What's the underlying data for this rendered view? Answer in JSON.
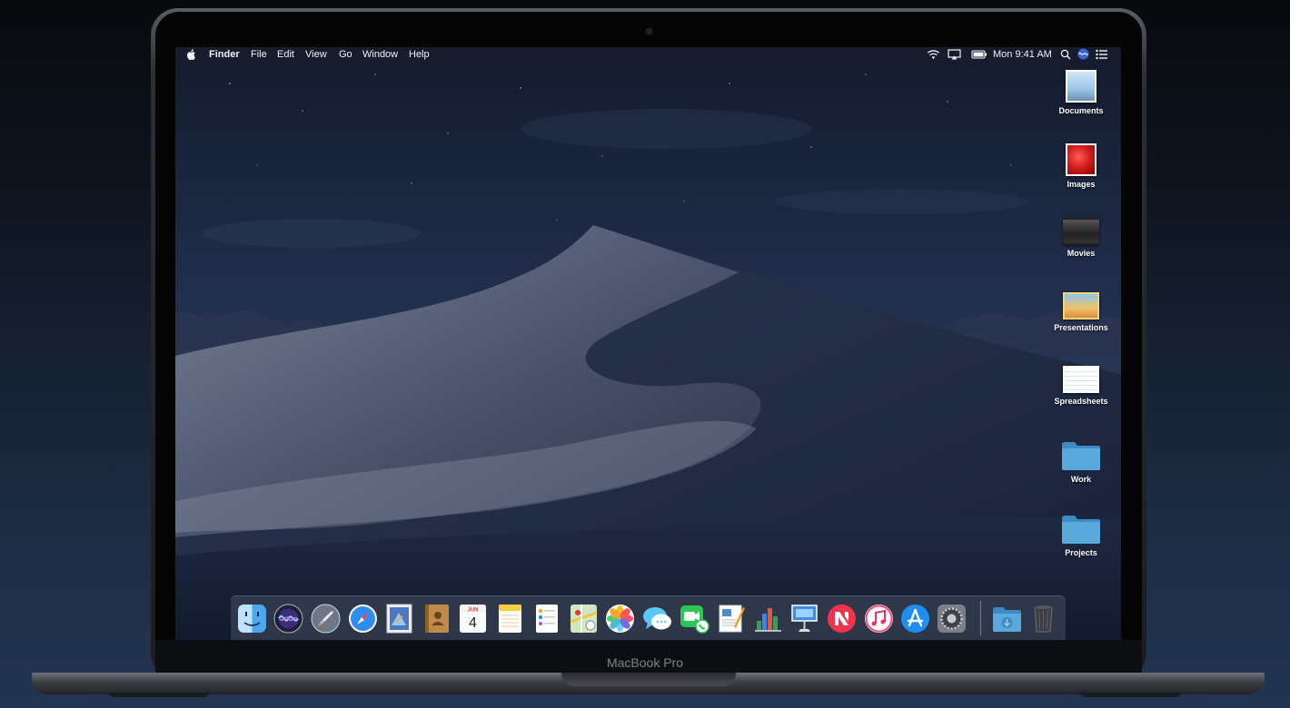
{
  "menubar": {
    "apple": "",
    "app_name": "Finder",
    "menus": [
      "File",
      "Edit",
      "View",
      "Go",
      "Window",
      "Help"
    ],
    "clock": "Mon 9:41 AM",
    "status_icons": [
      "wifi-icon",
      "airplay-icon",
      "battery-icon",
      "spotlight-icon",
      "siri-icon",
      "notification-center-icon"
    ]
  },
  "desktop": {
    "icons": [
      {
        "label": "Documents",
        "icon": "documents-stack-icon"
      },
      {
        "label": "Images",
        "icon": "images-stack-icon"
      },
      {
        "label": "Movies",
        "icon": "movies-stack-icon"
      },
      {
        "label": "Presentations",
        "icon": "presentations-stack-icon"
      },
      {
        "label": "Spreadsheets",
        "icon": "spreadsheets-stack-icon"
      },
      {
        "label": "Work",
        "icon": "folder-icon"
      },
      {
        "label": "Projects",
        "icon": "folder-icon"
      }
    ]
  },
  "dock": {
    "apps": [
      {
        "name": "finder-icon",
        "running": true
      },
      {
        "name": "siri-icon"
      },
      {
        "name": "launchpad-icon"
      },
      {
        "name": "safari-icon"
      },
      {
        "name": "mail-icon"
      },
      {
        "name": "contacts-icon"
      },
      {
        "name": "calendar-icon",
        "month": "JUN",
        "day": "4"
      },
      {
        "name": "notes-icon"
      },
      {
        "name": "reminders-icon"
      },
      {
        "name": "maps-icon"
      },
      {
        "name": "photos-icon"
      },
      {
        "name": "messages-icon"
      },
      {
        "name": "facetime-icon"
      },
      {
        "name": "pages-icon"
      },
      {
        "name": "numbers-icon"
      },
      {
        "name": "keynote-icon"
      },
      {
        "name": "news-icon"
      },
      {
        "name": "itunes-icon"
      },
      {
        "name": "app-store-icon"
      },
      {
        "name": "system-preferences-icon"
      }
    ],
    "others": [
      {
        "name": "downloads-folder-icon"
      },
      {
        "name": "trash-icon"
      }
    ]
  },
  "device": {
    "model": "MacBook Pro"
  },
  "colors": {
    "folder_blue": "#5aa9dc",
    "wallpaper_sky": "#1e2a43"
  }
}
